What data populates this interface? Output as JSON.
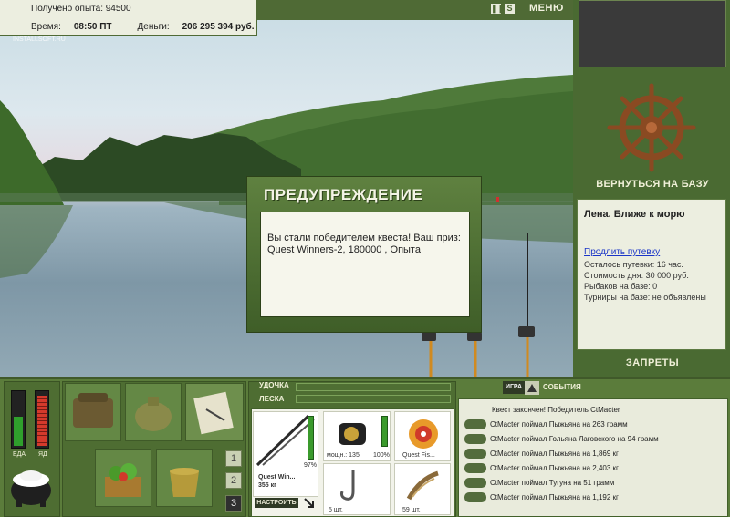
{
  "header": {
    "xp_text": "Получено опыта: 94500",
    "time_label": "Время:",
    "time_value": "08:50 ПТ",
    "money_label": "Деньги:",
    "money_value": "206 295 394 руб.",
    "menu_label": "МЕНЮ",
    "watermark": "INSTALLSOFT.RU",
    "pause_glyph": "❚❚",
    "sound_glyph": "S"
  },
  "right_panel": {
    "return_label": "ВЕРНУТЬСЯ НА БАЗУ",
    "location_title": "Лена. Ближе к морю",
    "extend_link": "Продлить путевку",
    "lines": [
      "Осталось путевки: 16 час.",
      "Стоимость дня: 30 000 руб.",
      "Рыбаков на базе: 0",
      "Турниры на базе: не объявлены"
    ],
    "bans_label": "ЗАПРЕТЫ"
  },
  "dialog": {
    "title": "ПРЕДУПРЕЖДЕНИЕ",
    "message_line1": "Вы стали победителем квеста! Ваш приз:",
    "message_line2": "Quest Winners-2, 180000 , Опыта"
  },
  "meters": {
    "food_label": "ЕДА",
    "poison_label": "ЯД",
    "food_level": 0.55,
    "poison_level": 0.95,
    "food_color": "#2fa02c",
    "poison_color": "#d63a2c"
  },
  "pages": [
    "1",
    "2",
    "3"
  ],
  "active_page": 2,
  "tackle": {
    "rod_label": "УДОЧКА",
    "line_label": "ЛЕСКА",
    "rod_name": "Quest Win...",
    "rod_weight": "355 кг",
    "rod_percent": "97%",
    "reel_power": "мощн.: 135",
    "reel_percent": "100%",
    "line_name": "Quest Fis...",
    "hook_count": "5 шт.",
    "bait_count": "59 шт.",
    "tune_label": "НАСТРОИТЬ"
  },
  "events": {
    "tab_game": "ИГРА",
    "tab_events": "СОБЫТИЯ",
    "header": "Квест закончен! Победитель CtMacter",
    "items": [
      "CtMacter поймал Пыжьяна на 263 грамм",
      "CtMacter поймал Гольяна Лаговского на 94 грамм",
      "CtMacter поймал Пыжьяна на 1,869 кг",
      "CtMacter поймал Пыжьяна на 2,403 кг",
      "CtMacter поймал Тугуна на 51 грамм",
      "CtMacter поймал Пыжьяна на 1,192 кг"
    ]
  }
}
